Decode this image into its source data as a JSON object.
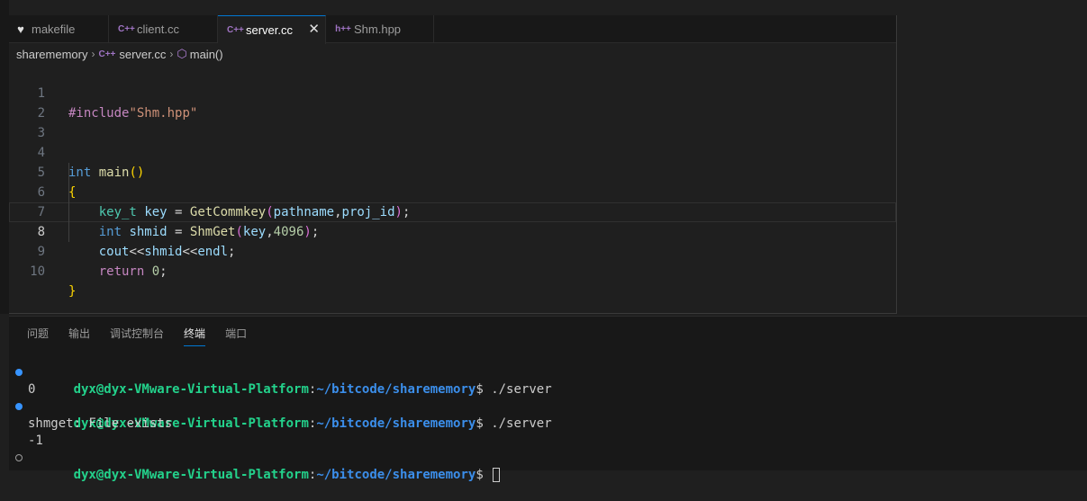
{
  "tabs": [
    {
      "label": "makefile",
      "icon": "makefile-icon",
      "active": false
    },
    {
      "label": "client.cc",
      "icon": "cpp-file-icon",
      "icon_text": "C++",
      "active": false
    },
    {
      "label": "server.cc",
      "icon": "cpp-file-icon",
      "icon_text": "C++",
      "active": true
    },
    {
      "label": "Shm.hpp",
      "icon": "hpp-file-icon",
      "icon_text": "h++",
      "active": false
    }
  ],
  "breadcrumb": {
    "folder": "sharememory",
    "file_icon_text": "C++",
    "file": "server.cc",
    "symbol": "main()"
  },
  "code": {
    "current_line": 8,
    "line_numbers": [
      "1",
      "2",
      "3",
      "4",
      "5",
      "6",
      "7",
      "8",
      "9",
      "10"
    ]
  },
  "code_tokens": {
    "l1_pre": "#include",
    "l1_str": "\"Shm.hpp\"",
    "l4_kw": "int",
    "l4_fn": "main",
    "l4_paren": "()",
    "l5_brace": "{",
    "l6_type": "key_t",
    "l6_var": "key",
    "l6_eq": " = ",
    "l6_fn": "GetCommkey",
    "l6_open": "(",
    "l6_arg1": "pathname",
    "l6_comma": ",",
    "l6_arg2": "proj_id",
    "l6_close": ")",
    "l6_semi": ";",
    "l7_kw": "int",
    "l7_var": "shmid",
    "l7_eq": " = ",
    "l7_fn": "ShmGet",
    "l7_open": "(",
    "l7_arg1": "key",
    "l7_comma": ",",
    "l7_num": "4096",
    "l7_close": ")",
    "l7_semi": ";",
    "l8_var1": "cout",
    "l8_op1": "<<",
    "l8_var2": "shmid",
    "l8_op2": "<<",
    "l8_var3": "endl",
    "l8_semi": ";",
    "l9_kw": "return",
    "l9_num": "0",
    "l9_semi": ";",
    "l10_brace": "}"
  },
  "panel_tabs": [
    {
      "label": "问题",
      "active": false
    },
    {
      "label": "输出",
      "active": false
    },
    {
      "label": "调试控制台",
      "active": false
    },
    {
      "label": "终端",
      "active": true
    },
    {
      "label": "端口",
      "active": false
    }
  ],
  "terminal": {
    "user": "dyx@dyx-VMware-Virtual-Platform",
    "colon": ":",
    "path": "~/bitcode/sharememory",
    "prompt": "$ ",
    "cmd1": "./server",
    "out1": "0",
    "cmd2": "./server",
    "out2a": "shmget: File exists",
    "out2b": "-1"
  },
  "colors": {
    "accent": "#0078d4",
    "terminal_user": "#23d18b",
    "terminal_path": "#3b8eea"
  }
}
